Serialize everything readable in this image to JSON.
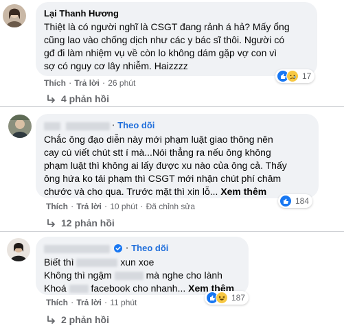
{
  "comments": [
    {
      "author": "Lại Thanh Hương",
      "lines": [
        "Thiệt là có người nghĩ là CSGT đang rảnh á hả? Mấy ổng",
        "cũng lao vào chống dịch như các y bác sĩ thôi. Người có",
        "gđ đi làm nhiệm vụ về còn lo không dám gặp vợ con vì",
        "sợ có nguy cơ lây nhiễm. Haizzzz"
      ],
      "reaction_count": "17",
      "reaction_icons": [
        "like-icon",
        "sad-icon"
      ],
      "actions": {
        "like": "Thích",
        "reply": "Trả lời",
        "time": "26 phút"
      },
      "replies_label": "4 phản hồi"
    },
    {
      "follow_label": "Theo dõi",
      "lines": [
        "Chắc ông đạo diễn này mới phạm luật giao thông nên",
        "cay cú viết chút stt í mà...Nói thẳng ra nếu ông không",
        "phạm luật thì không ai lấy được xu nào của ông cả. Thấy",
        "ông hứa ko tái phạm thì CSGT mới nhận chút phí châm",
        "chước và cho qua. Trước mặt thì xin lỗ..."
      ],
      "see_more": "Xem thêm",
      "reaction_count": "184",
      "reaction_icons": [
        "like-icon"
      ],
      "actions": {
        "like": "Thích",
        "reply": "Trả lời",
        "time": "10 phút",
        "edited": "Đã chỉnh sửa"
      },
      "replies_label": "12 phản hồi"
    },
    {
      "follow_label": "Theo dõi",
      "line1_a": "Biết thì ",
      "line1_b": "xun xoe",
      "line2_a": "Không thì ngậm ",
      "line2_b": "mà nghe cho lành",
      "line3_a": "Khoá ",
      "line3_b": "facebook cho nhanh...",
      "see_more": "Xem thêm",
      "reaction_count": "187",
      "reaction_icons": [
        "like-icon",
        "haha-icon"
      ],
      "actions": {
        "like": "Thích",
        "reply": "Trả lời",
        "time": "11 phút"
      },
      "replies_label": "2 phản hồi"
    }
  ],
  "colors": {
    "bubble": "#f0f2f5",
    "follow": "#216fdb",
    "muted": "#65676b",
    "like": "#1877f2"
  }
}
